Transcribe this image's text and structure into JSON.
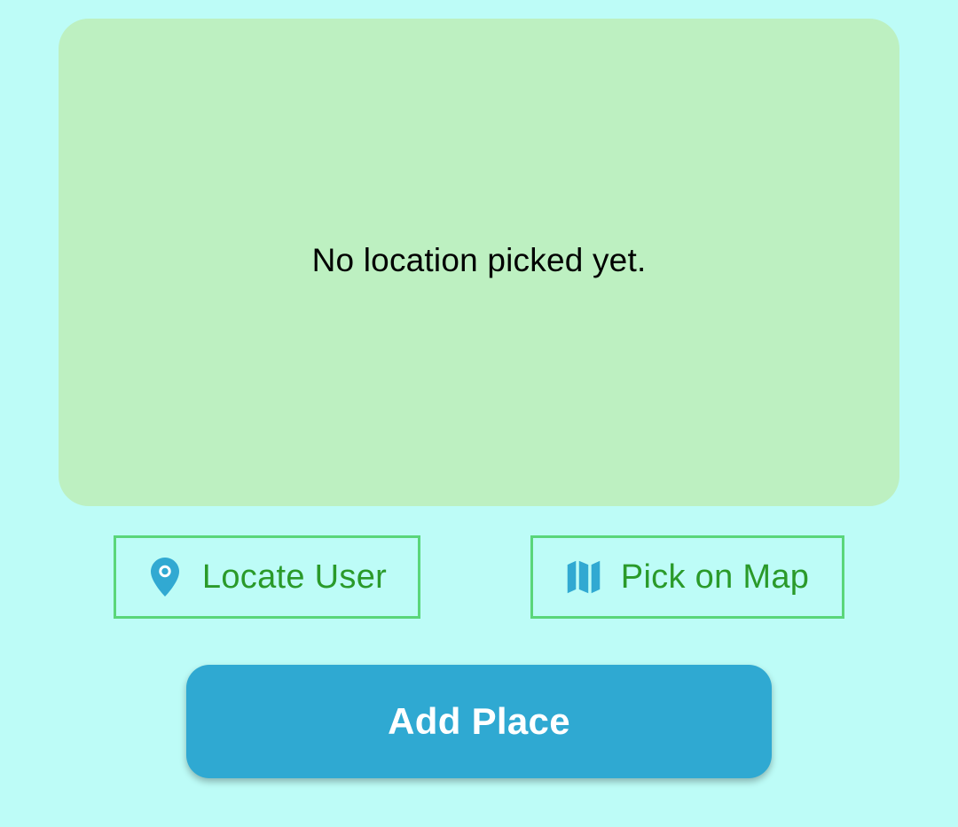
{
  "colors": {
    "background": "#bdfcf7",
    "preview_bg": "#bdf0c1",
    "outline_border": "#5ad67a",
    "outline_text": "#2a9a2a",
    "icon": "#31a9d2",
    "primary": "#2fa9d2",
    "primary_text": "#ffffff"
  },
  "location_preview": {
    "message": "No location picked yet."
  },
  "actions": {
    "locate_user": {
      "label": "Locate User",
      "icon": "location-pin-icon"
    },
    "pick_on_map": {
      "label": "Pick on Map",
      "icon": "map-icon"
    }
  },
  "submit": {
    "label": "Add Place"
  }
}
